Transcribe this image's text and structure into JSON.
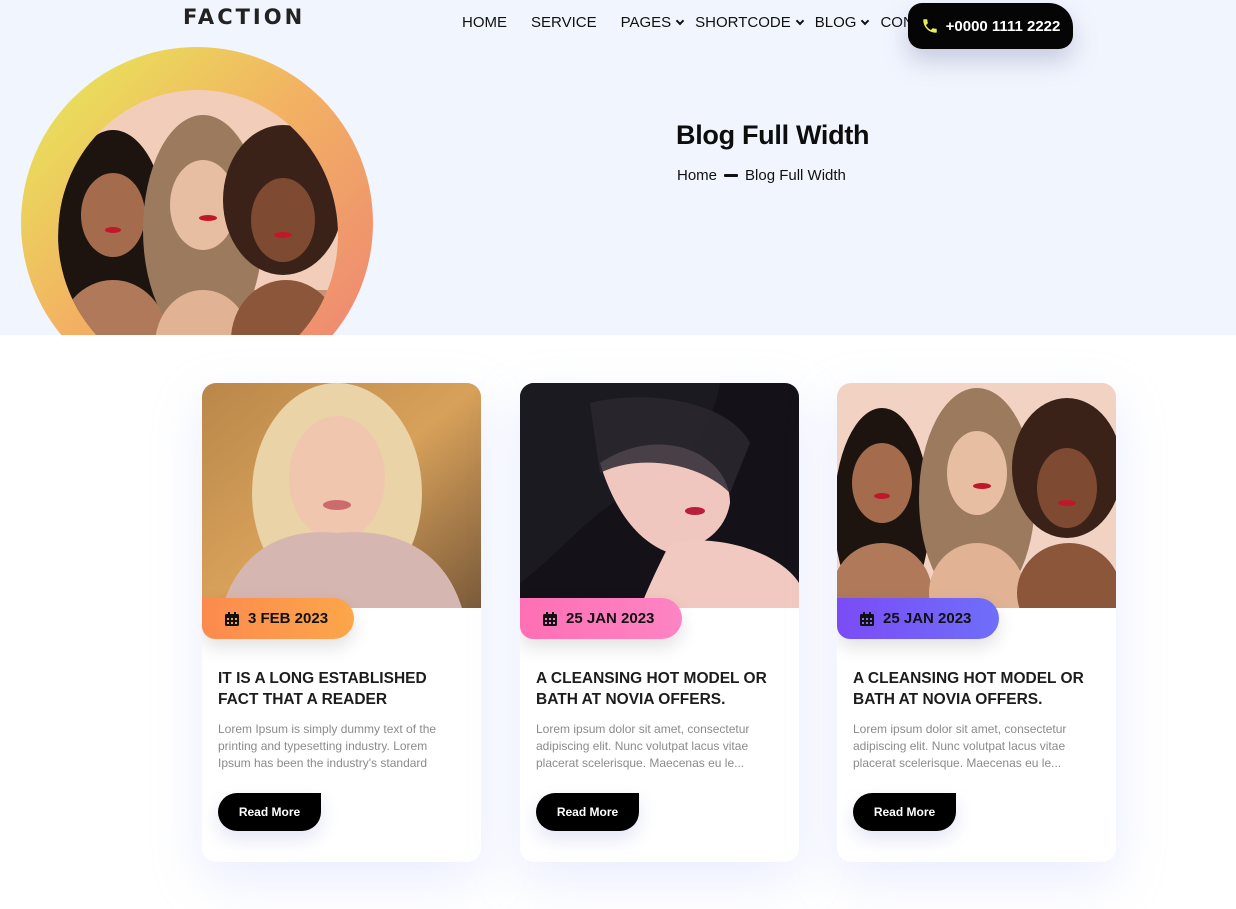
{
  "header": {
    "logo": "FACTION",
    "nav": [
      {
        "label": "HOME"
      },
      {
        "label": "SERVICE"
      },
      {
        "label": "PAGES"
      },
      {
        "label": "SHORTCODE"
      },
      {
        "label": "BLOG"
      },
      {
        "label": "CONTACT"
      }
    ],
    "phone": "+0000 1111 2222"
  },
  "hero": {
    "title": "Blog Full Width",
    "breadcrumb": {
      "home": "Home",
      "current": "Blog Full Width"
    }
  },
  "posts": [
    {
      "date": "3 FEB 2023",
      "title": "IT IS A LONG ESTABLISHED FACT THAT A READER",
      "excerpt": "Lorem Ipsum is simply dummy text of the printing and typesetting industry. Lorem Ipsum has been the industry's standard",
      "button": "Read More"
    },
    {
      "date": "25 JAN 2023",
      "title": "A CLEANSING HOT MODEL OR BATH AT NOVIA OFFERS.",
      "excerpt": "Lorem ipsum dolor sit amet, consectetur adipiscing elit. Nunc volutpat lacus vitae placerat scelerisque. Maecenas eu le...",
      "button": "Read More"
    },
    {
      "date": "25 JAN 2023",
      "title": "A CLEANSING HOT MODEL OR BATH AT NOVIA OFFERS.",
      "excerpt": "Lorem ipsum dolor sit amet, consectetur adipiscing elit. Nunc volutpat lacus vitae placerat scelerisque. Maecenas eu le...",
      "button": "Read More"
    }
  ],
  "colors": {
    "hero_bg": "#f1f5fe",
    "badge_orange": "#fc8a4e",
    "badge_pink": "#ff6fb4",
    "badge_purple": "#7b4cf6",
    "button_bg": "#000000"
  }
}
